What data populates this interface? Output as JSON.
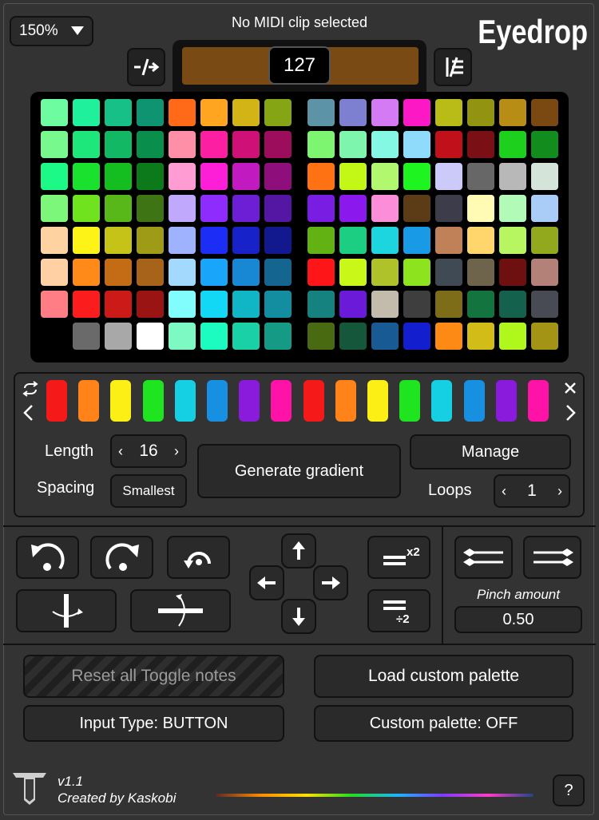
{
  "zoom": {
    "value": "150%"
  },
  "status": {
    "text": "No MIDI clip selected"
  },
  "brand": {
    "logo": "Eyedrop",
    "version": "v1.1",
    "credit": "Created by Kaskobi"
  },
  "velocity": {
    "value": "127",
    "color": "#7a4a15"
  },
  "pad_grid_left": [
    [
      "#6dfca0",
      "#1ef09c",
      "#17c086",
      "#0e9470",
      "#fe6a18",
      "#ffa520",
      "#d2b417",
      "#86a515"
    ],
    [
      "#78f98d",
      "#1de67a",
      "#13b865",
      "#0a8e4c",
      "#ff8fa7",
      "#fd1fa2",
      "#cf1076",
      "#9c0e5c"
    ],
    [
      "#1df987",
      "#1ae02e",
      "#14bd20",
      "#0c7a1a",
      "#ff9cd4",
      "#fd1fd8",
      "#c11ac0",
      "#8e0f7c"
    ],
    [
      "#7cf779",
      "#6fe41e",
      "#58b81a",
      "#3e7414",
      "#c0a8fd",
      "#8e2cfd",
      "#6d1fd5",
      "#5417a3"
    ],
    [
      "#ffd3a1",
      "#fdf316",
      "#c6c318",
      "#9e9c17",
      "#9fb2fe",
      "#1c2ef5",
      "#1722c8",
      "#12198e"
    ],
    [
      "#ffd0a3",
      "#ff8a1a",
      "#c46c15",
      "#a8631a",
      "#a4d9fe",
      "#19a6fa",
      "#1888d5",
      "#146690"
    ],
    [
      "#ff7e85",
      "#fb1d1d",
      "#cb1a17",
      "#9b1414",
      "#81fdfd",
      "#12d8f5",
      "#11b6c6",
      "#138ea0"
    ],
    [
      "",
      "#6a6a6a",
      "#a8a8a8",
      "#ffffff",
      "#7dfac4",
      "#1cfcc1",
      "#1ad0a6",
      "#149a85"
    ]
  ],
  "pad_grid_right": [
    [
      "#5d93a7",
      "#7d80d0",
      "#d47af4",
      "#fd18c6",
      "#b9bb16",
      "#939312",
      "#b88d16",
      "#7a4912"
    ],
    [
      "#7df570",
      "#7df5ac",
      "#84f8e2",
      "#8edbfc",
      "#c0111a",
      "#7a0f15",
      "#1dd01d",
      "#128c1c"
    ],
    [
      "#ff7214",
      "#c2f716",
      "#b1f86e",
      "#1ef41f",
      "#cbcaf8",
      "#676767",
      "#b8b8b8",
      "#d4e4d8"
    ],
    [
      "#7a1de2",
      "#8b19ee",
      "#fc8dd9",
      "#5c3c16",
      "#3c3c4a",
      "#fffbb5",
      "#b1fab8",
      "#a9cdf7"
    ],
    [
      "#62b214",
      "#1bce81",
      "#1dd5df",
      "#199ae6",
      "#c08058",
      "#fed66c",
      "#b7f561",
      "#92a91e"
    ],
    [
      "#fd1518",
      "#c9f718",
      "#b0c22a",
      "#8ce31e",
      "#404a55",
      "#6e634b",
      "#6e1010",
      "#b38178"
    ],
    [
      "#168280",
      "#6a1ad8",
      "#c3bbac",
      "#3e3e3e",
      "#7d6d18",
      "#137440",
      "#14614e",
      "#484a54"
    ],
    [
      "#4a6a12",
      "#14573a",
      "#175a94",
      "#131fce",
      "#fe8a16",
      "#d2bd18",
      "#b0f81c",
      "#a49416"
    ]
  ],
  "sequence": {
    "colors": [
      "#f5191a",
      "#ff8319",
      "#fbef16",
      "#1ee51f",
      "#15d0e2",
      "#1790e2",
      "#8a1bdc",
      "#ff12a8",
      "#f5191a",
      "#ff8319",
      "#fbef16",
      "#1ee51f",
      "#15d0e2",
      "#1790e2",
      "#8a1bdc",
      "#ff12a8"
    ],
    "length_label": "Length",
    "length_value": "16",
    "spacing_label": "Spacing",
    "spacing_value": "Smallest",
    "generate_label": "Generate gradient",
    "manage_label": "Manage",
    "loops_label": "Loops",
    "loops_value": "1"
  },
  "transform": {
    "pinch_label": "Pinch amount",
    "pinch_value": "0.50",
    "double_label": "x2",
    "half_label": "÷2"
  },
  "bottom": {
    "reset_label": "Reset all Toggle notes",
    "load_label": "Load custom palette",
    "input_type_label": "Input Type: BUTTON",
    "custom_palette_label": "Custom palette: OFF"
  },
  "help": {
    "label": "?"
  }
}
